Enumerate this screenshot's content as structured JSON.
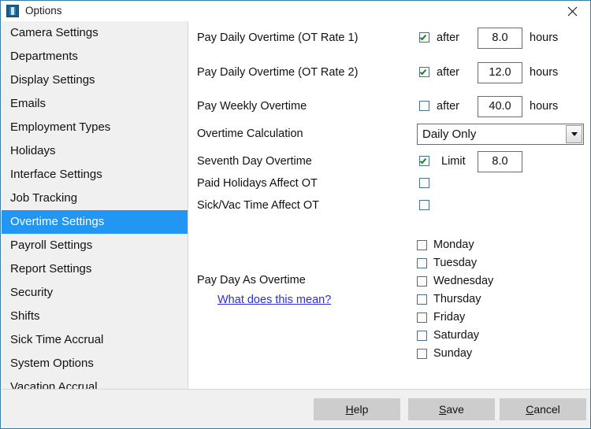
{
  "window": {
    "title": "Options",
    "icon": "options-window-icon",
    "close_icon": "close-icon",
    "accent_color": "#2196f3",
    "border_color": "#3a7ca8"
  },
  "sidebar": {
    "selected": "Overtime Settings",
    "items": [
      {
        "label": "Camera Settings",
        "selected": false
      },
      {
        "label": "Departments",
        "selected": false
      },
      {
        "label": "Display Settings",
        "selected": false
      },
      {
        "label": "Emails",
        "selected": false
      },
      {
        "label": "Employment Types",
        "selected": false
      },
      {
        "label": "Holidays",
        "selected": false
      },
      {
        "label": "Interface Settings",
        "selected": false
      },
      {
        "label": "Job Tracking",
        "selected": false
      },
      {
        "label": "Overtime Settings",
        "selected": true
      },
      {
        "label": "Payroll Settings",
        "selected": false
      },
      {
        "label": "Report Settings",
        "selected": false
      },
      {
        "label": "Security",
        "selected": false
      },
      {
        "label": "Shifts",
        "selected": false
      },
      {
        "label": "Sick Time Accrual",
        "selected": false
      },
      {
        "label": "System Options",
        "selected": false
      },
      {
        "label": "Vacation Accrual",
        "selected": false
      }
    ]
  },
  "main": {
    "ot_rate_1": {
      "label": "Pay Daily Overtime (OT Rate 1)",
      "checked": true,
      "qualifier": "after",
      "value": "8.0",
      "unit": "hours"
    },
    "ot_rate_2": {
      "label": "Pay Daily Overtime (OT Rate 2)",
      "checked": true,
      "qualifier": "after",
      "value": "12.0",
      "unit": "hours"
    },
    "weekly_ot": {
      "label": "Pay Weekly Overtime",
      "checked": false,
      "qualifier": "after",
      "value": "40.0",
      "unit": "hours"
    },
    "ot_calculation": {
      "label": "Overtime Calculation",
      "value": "Daily Only"
    },
    "seventh_day": {
      "label": "Seventh Day Overtime",
      "checked": true,
      "qualifier": "Limit",
      "value": "8.0"
    },
    "paid_holidays": {
      "label": "Paid Holidays Affect OT",
      "checked": false
    },
    "sick_vac": {
      "label": "Sick/Vac Time Affect OT",
      "checked": false
    },
    "pay_day_as_overtime": {
      "label": "Pay Day As Overtime",
      "help_link": "What does this mean?",
      "link_color": "#2d2ddb"
    },
    "days": [
      {
        "label": "Monday",
        "checked": false
      },
      {
        "label": "Tuesday",
        "checked": false
      },
      {
        "label": "Wednesday",
        "checked": false
      },
      {
        "label": "Thursday",
        "checked": false
      },
      {
        "label": "Friday",
        "checked": false
      },
      {
        "label": "Saturday",
        "checked": false
      },
      {
        "label": "Sunday",
        "checked": false
      }
    ]
  },
  "footer": {
    "help": {
      "accel": "H",
      "rest": "elp"
    },
    "save": {
      "accel": "S",
      "rest": "ave"
    },
    "cancel": {
      "accel": "C",
      "rest": "ancel"
    }
  }
}
